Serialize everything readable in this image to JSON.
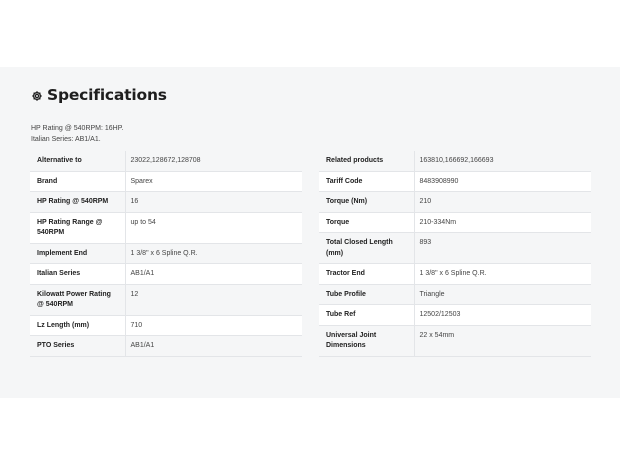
{
  "section": {
    "title": "Specifications",
    "icon": "gear-icon"
  },
  "intro": {
    "line1": "HP Rating @ 540RPM: 16HP.",
    "line2": "Italian Series: AB1/A1."
  },
  "left_table": [
    {
      "label": "Alternative to",
      "value": "23022,128672,128708"
    },
    {
      "label": "Brand",
      "value": "Sparex"
    },
    {
      "label": "HP Rating @ 540RPM",
      "value": "16"
    },
    {
      "label": "HP Rating Range @ 540RPM",
      "value": "up to 54"
    },
    {
      "label": "Implement End",
      "value": "1 3/8\" x 6 Spline Q.R."
    },
    {
      "label": "Italian Series",
      "value": "AB1/A1"
    },
    {
      "label": "Kilowatt Power Rating @ 540RPM",
      "value": "12"
    },
    {
      "label": "Lz Length (mm)",
      "value": "710"
    },
    {
      "label": "PTO Series",
      "value": "AB1/A1"
    }
  ],
  "right_table": [
    {
      "label": "Related products",
      "value": "163810,166692,166693"
    },
    {
      "label": "Tariff Code",
      "value": "8483908990"
    },
    {
      "label": "Torque (Nm)",
      "value": "210"
    },
    {
      "label": "Torque",
      "value": "210-334Nm"
    },
    {
      "label": "Total Closed Length (mm)",
      "value": "893"
    },
    {
      "label": "Tractor End",
      "value": "1 3/8\" x 6 Spline Q.R."
    },
    {
      "label": "Tube Profile",
      "value": "Triangle"
    },
    {
      "label": "Tube Ref",
      "value": "12502/12503"
    },
    {
      "label": "Universal Joint Dimensions",
      "value": "22 x 54mm"
    }
  ],
  "colors": {
    "panel_background": "#f5f6f7",
    "row_alt": "#ffffff",
    "border": "#e3e5e8"
  }
}
